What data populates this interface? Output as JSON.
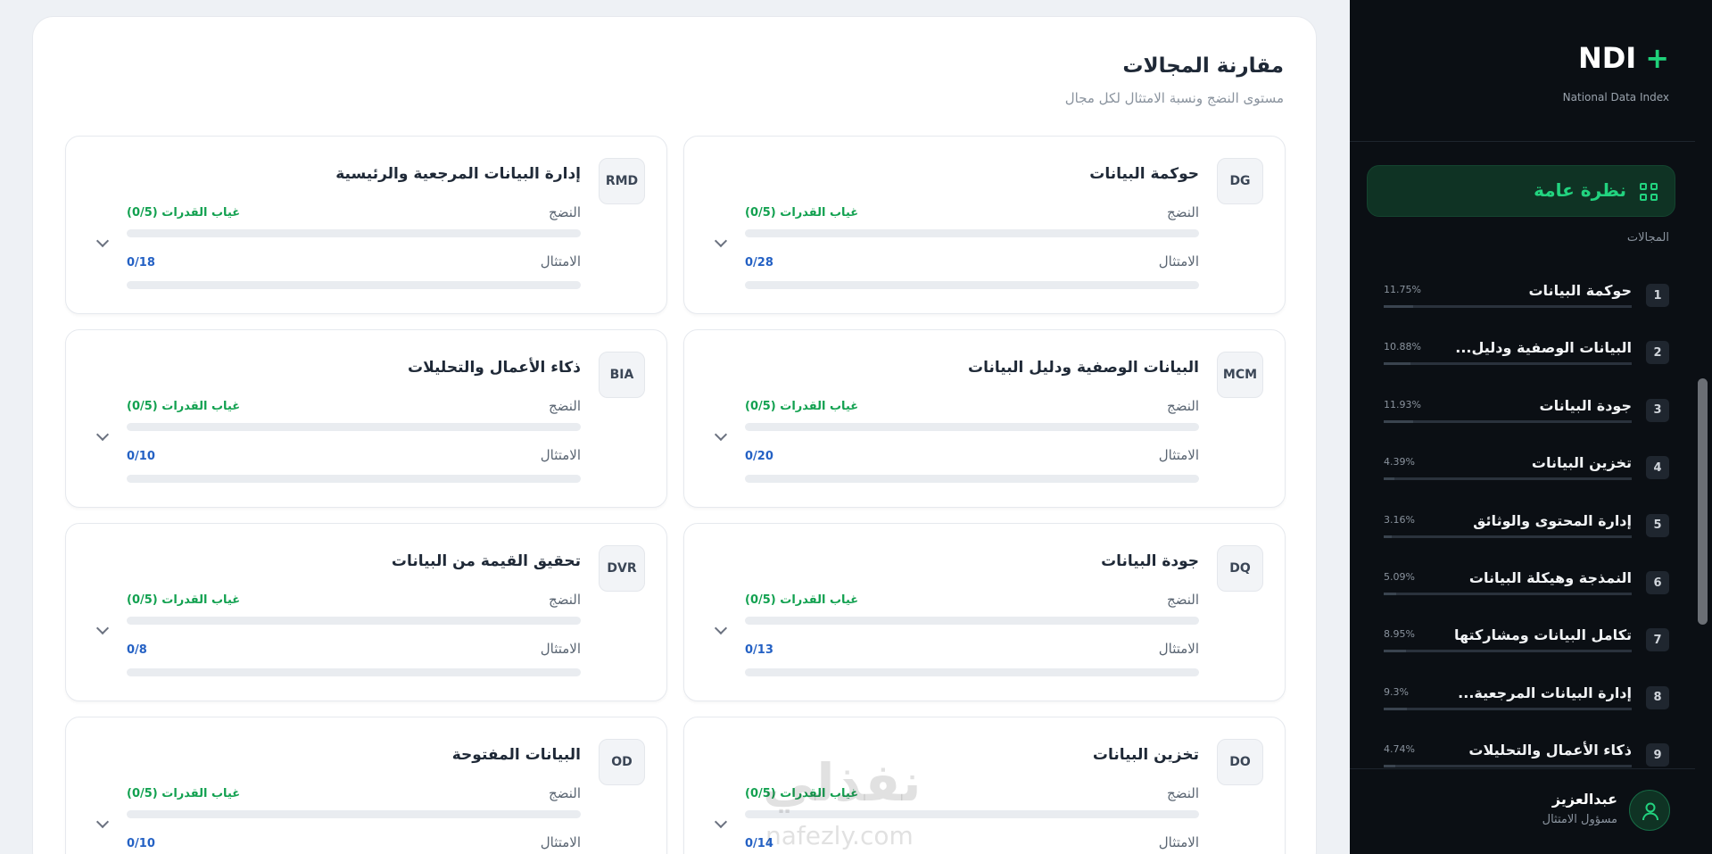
{
  "main": {
    "title": "مقارنة المجالات",
    "subtitle": "مستوى النضج ونسبة الامتثال لكل مجال",
    "maturity_label": "النضج",
    "compliance_label": "الامتثال",
    "cards": [
      {
        "code": "DG",
        "name": "حوكمة البيانات",
        "maturity": "غياب القدرات (0/5)",
        "compliance": "0/28",
        "maturity_progress": 0,
        "compliance_progress": 0
      },
      {
        "code": "RMD",
        "name": "إدارة البيانات المرجعية والرئيسية",
        "maturity": "غياب القدرات (0/5)",
        "compliance": "0/18",
        "maturity_progress": 0,
        "compliance_progress": 0
      },
      {
        "code": "MCM",
        "name": "البيانات الوصفية ودليل البيانات",
        "maturity": "غياب القدرات (0/5)",
        "compliance": "0/20",
        "maturity_progress": 0,
        "compliance_progress": 0
      },
      {
        "code": "BIA",
        "name": "ذكاء الأعمال والتحليلات",
        "maturity": "غياب القدرات (0/5)",
        "compliance": "0/10",
        "maturity_progress": 0,
        "compliance_progress": 0
      },
      {
        "code": "DQ",
        "name": "جودة البيانات",
        "maturity": "غياب القدرات (0/5)",
        "compliance": "0/13",
        "maturity_progress": 0,
        "compliance_progress": 0
      },
      {
        "code": "DVR",
        "name": "تحقيق القيمة من البيانات",
        "maturity": "غياب القدرات (0/5)",
        "compliance": "0/8",
        "maturity_progress": 0,
        "compliance_progress": 0
      },
      {
        "code": "DO",
        "name": "تخزين البيانات",
        "maturity": "غياب القدرات (0/5)",
        "compliance": "0/14",
        "maturity_progress": 0,
        "compliance_progress": 0
      },
      {
        "code": "OD",
        "name": "البيانات المفتوحة",
        "maturity": "غياب القدرات (0/5)",
        "compliance": "0/10",
        "maturity_progress": 0,
        "compliance_progress": 0
      }
    ]
  },
  "sidebar": {
    "logo": "NDI",
    "logo_plus": "+",
    "logo_subtitle": "National Data Index",
    "overview_label": "نظرة عامة",
    "section_label": "المجالات",
    "domains": [
      {
        "num": "1",
        "name": "حوكمة البيانات",
        "pct": "11.75%",
        "weight": 0.1175
      },
      {
        "num": "2",
        "name": "البيانات الوصفية ودليل...",
        "pct": "10.88%",
        "weight": 0.1088
      },
      {
        "num": "3",
        "name": "جودة البيانات",
        "pct": "11.93%",
        "weight": 0.1193
      },
      {
        "num": "4",
        "name": "تخزين البيانات",
        "pct": "4.39%",
        "weight": 0.0439
      },
      {
        "num": "5",
        "name": "إدارة المحتوى والوثائق",
        "pct": "3.16%",
        "weight": 0.0316
      },
      {
        "num": "6",
        "name": "النمذجة وهيكلة البيانات",
        "pct": "5.09%",
        "weight": 0.0509
      },
      {
        "num": "7",
        "name": "تكامل البيانات ومشاركتها",
        "pct": "8.95%",
        "weight": 0.0895
      },
      {
        "num": "8",
        "name": "إدارة البيانات المرجعية...",
        "pct": "9.3%",
        "weight": 0.093
      },
      {
        "num": "9",
        "name": "ذكاء الأعمال والتحليلات",
        "pct": "4.74%",
        "weight": 0.0474
      }
    ],
    "user": {
      "name": "عبدالعزيز",
      "role": "مسؤول الامتثال"
    }
  },
  "watermark": {
    "arabic": "نفذلي",
    "latin": "nafezly.com"
  },
  "colors": {
    "accent_green": "#12a150",
    "accent_blue": "#2461c4",
    "sidebar_bg": "#0b0f14",
    "overview_green": "#22d37f"
  }
}
